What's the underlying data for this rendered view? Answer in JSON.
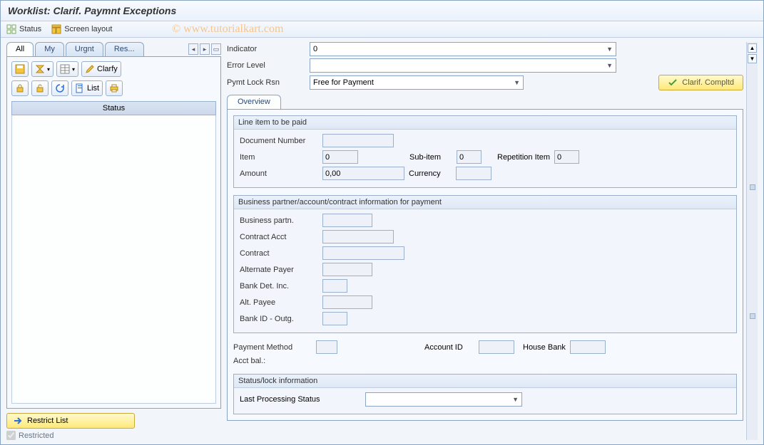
{
  "title": "Worklist: Clarif. Paymnt Exceptions",
  "menu": {
    "status": "Status",
    "screen_layout": "Screen layout"
  },
  "watermark": "© www.tutorialkart.com",
  "tabs": {
    "all": "All",
    "my": "My",
    "urgnt": "Urgnt",
    "res": "Res..."
  },
  "left_toolbar": {
    "clarfy": "Clarfy",
    "list": "List"
  },
  "status_header": "Status",
  "restrict": {
    "button": "Restrict List",
    "checkbox": "Restricted"
  },
  "top_form": {
    "indicator_label": "Indicator",
    "indicator_value": "0",
    "error_level_label": "Error Level",
    "error_level_value": "",
    "pymt_lock_label": "Pymt Lock Rsn",
    "pymt_lock_value": "Free for Payment",
    "completed": "Clarif. Compltd"
  },
  "subtab": {
    "overview": "Overview"
  },
  "group1": {
    "title": "Line item to be paid",
    "doc_num_label": "Document Number",
    "item_label": "Item",
    "item_val": "0",
    "subitem_label": "Sub-item",
    "subitem_val": "0",
    "repitem_label": "Repetition Item",
    "repitem_val": "0",
    "amount_label": "Amount",
    "amount_val": "0,00",
    "currency_label": "Currency"
  },
  "group2": {
    "title": "Business partner/account/contract information for payment",
    "bp_label": "Business partn.",
    "ca_label": "Contract Acct",
    "co_label": "Contract",
    "ap_label": "Alternate Payer",
    "bd_label": "Bank Det. Inc.",
    "alp_label": "Alt. Payee",
    "bid_label": "Bank ID - Outg."
  },
  "group3": {
    "pm_label": "Payment Method",
    "acct_label": "Account ID",
    "hb_label": "House Bank",
    "bal_label": "Acct bal.:"
  },
  "group4": {
    "title": "Status/lock information",
    "lps_label": "Last Processing Status",
    "lps_value": ""
  }
}
